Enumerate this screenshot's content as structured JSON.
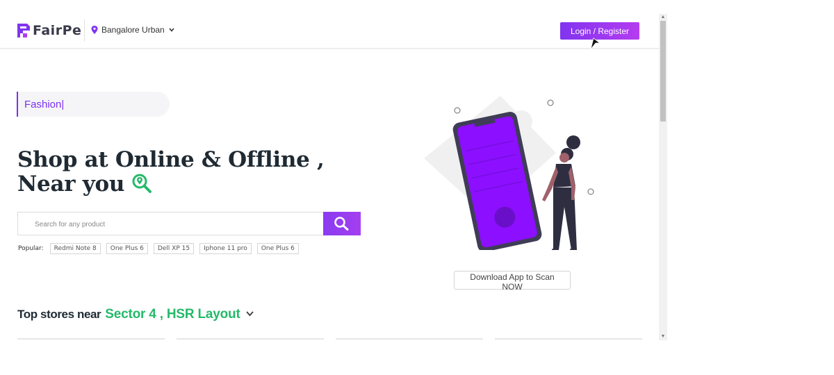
{
  "header": {
    "logo_text": "FairPe",
    "location": "Bangalore Urban",
    "login_label": "Login / Register"
  },
  "hero": {
    "typed_text": "Fashion|",
    "headline_line1": "Shop at Online & Offline ,",
    "headline_line2": "Near you"
  },
  "search": {
    "placeholder": "Search for any product",
    "popular_label": "Popular:",
    "popular_items": [
      "Redmi Note 8",
      "One Plus 6",
      "Dell XP 15",
      "Iphone 11 pro",
      "One Plus 6"
    ]
  },
  "download": {
    "label": "Download App to Scan NOW"
  },
  "stores": {
    "heading": "Top stores near",
    "area": "Sector 4 , HSR Layout"
  },
  "colors": {
    "brand_purple": "#8134ef",
    "accent_green": "#25b96a",
    "heading_dark": "#1f2a33"
  }
}
